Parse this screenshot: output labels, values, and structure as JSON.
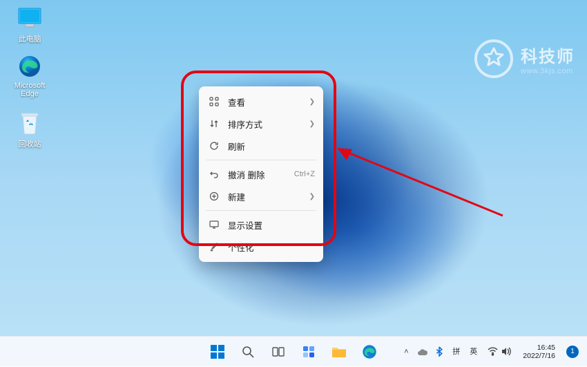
{
  "desktop_icons": {
    "this_pc": "此电脑",
    "edge": "Microsoft Edge",
    "recycle": "回收站"
  },
  "context_menu": {
    "view": "查看",
    "sort": "排序方式",
    "refresh": "刷新",
    "undo_delete": "撤消 删除",
    "undo_shortcut": "Ctrl+Z",
    "new": "新建",
    "display_settings": "显示设置",
    "personalize": "个性化"
  },
  "watermark": {
    "title": "科技师",
    "url": "www.3kjs.com"
  },
  "ime": {
    "line1": "拼",
    "line2": "英"
  },
  "clock": {
    "time": "16:45",
    "date": "2022/7/16"
  },
  "notification_count": "1"
}
